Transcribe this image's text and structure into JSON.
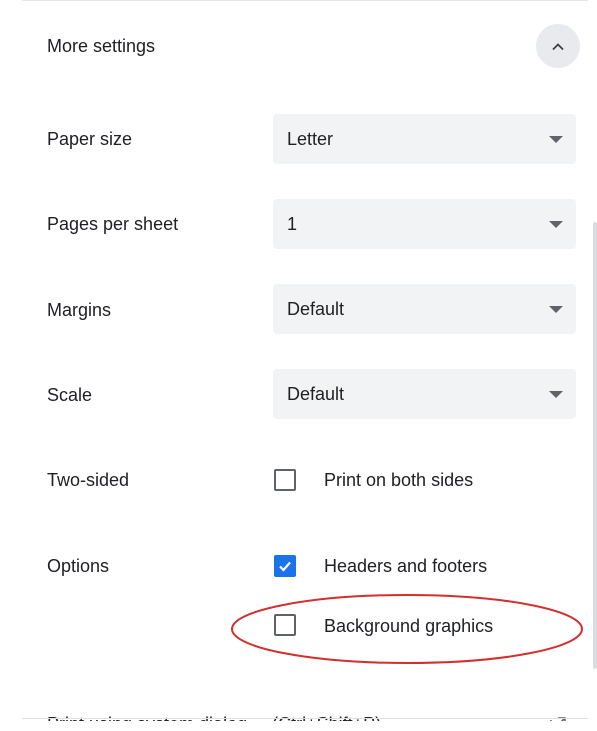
{
  "header": {
    "title": "More settings",
    "collapse_icon": "chevron-up-icon"
  },
  "settings": {
    "paper_size": {
      "label": "Paper size",
      "value": "Letter"
    },
    "pages_per_sheet": {
      "label": "Pages per sheet",
      "value": "1"
    },
    "margins": {
      "label": "Margins",
      "value": "Default"
    },
    "scale": {
      "label": "Scale",
      "value": "Default"
    },
    "two_sided": {
      "label": "Two-sided",
      "option": "Print on both sides",
      "checked": false
    },
    "options": {
      "label": "Options",
      "headers_footers": {
        "label": "Headers and footers",
        "checked": true
      },
      "background_graphics": {
        "label": "Background graphics",
        "checked": false
      }
    }
  },
  "footer": {
    "system_dialog_label": "Print using system dialog...",
    "system_dialog_shortcut": "(Ctrl+Shift+P)",
    "open_icon": "open-in-new-icon"
  },
  "colors": {
    "accent": "#1a73e8",
    "annotation": "#d32f2f",
    "select_bg": "#f1f3f4"
  }
}
